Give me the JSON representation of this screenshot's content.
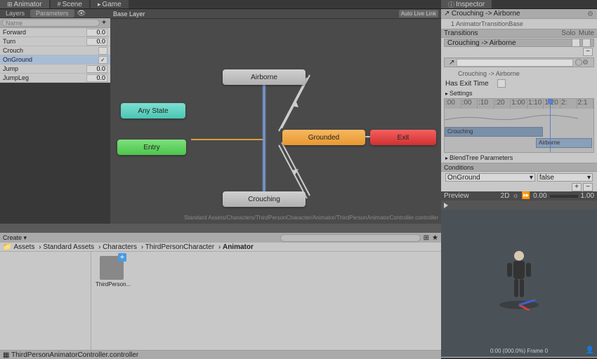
{
  "tabs": {
    "animator": "Animator",
    "scene": "Scene",
    "game": "Game",
    "inspector": "Inspector"
  },
  "subtabs": {
    "layers": "Layers",
    "parameters": "Parameters"
  },
  "graph": {
    "crumb": "Base Layer",
    "autolive": "Auto Live Link",
    "status": "Standard Assets/Characters/ThirdPersonCharacter/Animator/ThirdPersonAnimatorController.controller"
  },
  "params": {
    "searchPlaceholder": "Name",
    "items": [
      {
        "name": "Forward",
        "val": "0.0",
        "type": "float"
      },
      {
        "name": "Turn",
        "val": "0.0",
        "type": "float"
      },
      {
        "name": "Crouch",
        "val": "",
        "type": "bool",
        "checked": false
      },
      {
        "name": "OnGround",
        "val": "",
        "type": "bool",
        "checked": true,
        "sel": true
      },
      {
        "name": "Jump",
        "val": "0.0",
        "type": "float"
      },
      {
        "name": "JumpLeg",
        "val": "0.0",
        "type": "float"
      }
    ]
  },
  "nodes": {
    "anystate": "Any State",
    "entry": "Entry",
    "airborne": "Airborne",
    "grounded": "Grounded",
    "crouching": "Crouching",
    "exit": "Exit"
  },
  "project": {
    "crumbs": [
      "Assets",
      "Standard Assets",
      "Characters",
      "ThirdPersonCharacter",
      "Animator"
    ],
    "assetLabel": "ThirdPerson...",
    "footer": "ThirdPersonAnimatorController.controller"
  },
  "inspector": {
    "title": "Crouching -> Airborne",
    "sub": "1 AnimatorTransitionBase",
    "transitionsHdr": "Transitions",
    "solo": "Solo",
    "mute": "Mute",
    "transitionItem": "Crouching -> Airborne",
    "nameField": "Crouching -> Airborne",
    "hasExit": "Has Exit Time",
    "settings": "Settings",
    "blendtree": "BlendTree Parameters",
    "conditions": "Conditions",
    "condParam": "OnGround",
    "condVal": "false",
    "ruler": [
      ":00",
      ":00",
      ":10",
      ":20",
      "1:00",
      "1:10",
      "1:20",
      "2:",
      "2:1"
    ],
    "blockA": "Crouching",
    "blockB": "Airborne",
    "preview": {
      "label": "Preview",
      "mode": "2D",
      "zero": "0.00",
      "one": "1.00",
      "footer": "0:00 (000.0%) Frame 0"
    }
  }
}
